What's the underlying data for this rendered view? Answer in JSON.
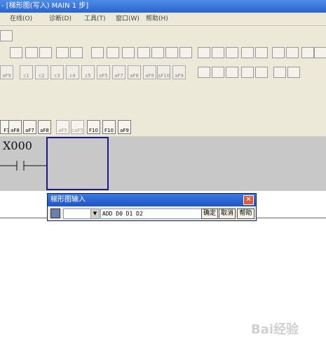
{
  "titlebar": {
    "text": "- [梯形图(写入)    MAIN    1 步]"
  },
  "menu": {
    "items": [
      "在线(O)",
      "诊断(D)",
      "工具(T)",
      "窗口(W)",
      "帮助(H)"
    ]
  },
  "toolbar": {
    "row2_labels": [
      "aF9",
      "c1",
      "c2",
      "c3",
      "c4",
      "c5",
      "aF5",
      "aF7",
      "aF8",
      "aF9",
      "aF10",
      "aF9"
    ],
    "row3_labels": [
      "F7",
      "aF8",
      "aF7",
      "aF8",
      "aF5",
      "caF5",
      "F10",
      "F10",
      "aF9"
    ]
  },
  "ladder": {
    "contact_label": "X000"
  },
  "dialog": {
    "title": "梯形图输入",
    "close_glyph": "✕",
    "input_value": "ADD D0 D1 D2",
    "ok_label": "确定",
    "cancel_label": "取消",
    "help_label": "帮助"
  },
  "watermark": {
    "text": "Bai经验"
  }
}
